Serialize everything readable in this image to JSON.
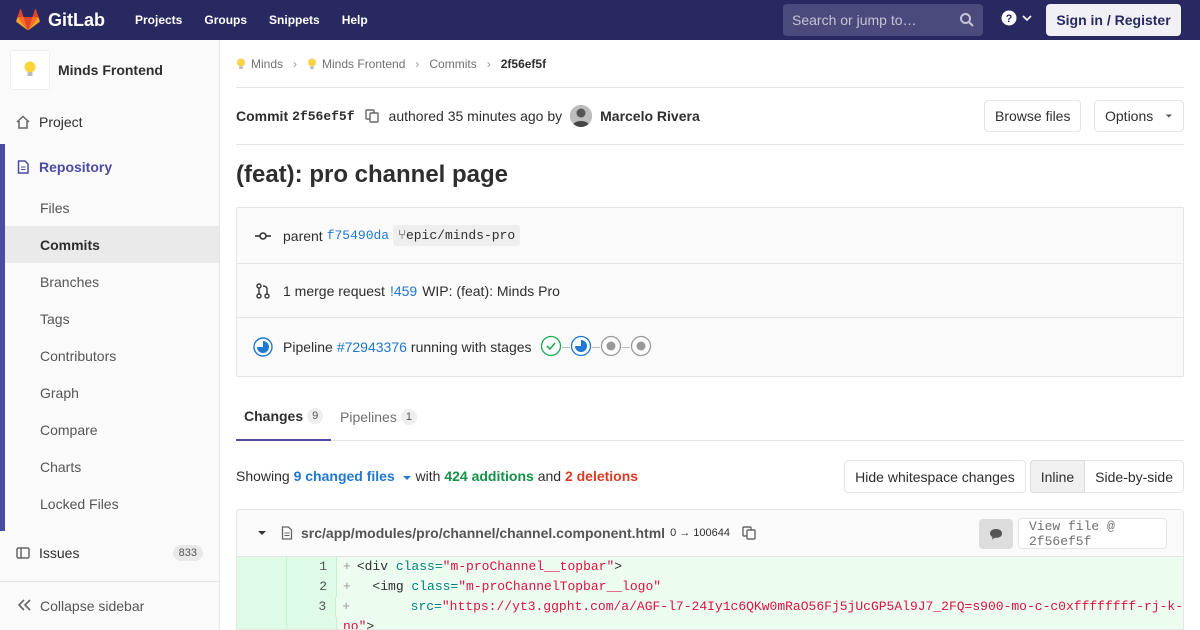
{
  "navbar": {
    "brand": "GitLab",
    "links": [
      "Projects",
      "Groups",
      "Snippets",
      "Help"
    ],
    "search_placeholder": "Search or jump to…",
    "signin": "Sign in / Register"
  },
  "sidebar": {
    "project_name": "Minds Frontend",
    "project": "Project",
    "repository": "Repository",
    "repo_items": [
      "Files",
      "Commits",
      "Branches",
      "Tags",
      "Contributors",
      "Graph",
      "Compare",
      "Charts",
      "Locked Files"
    ],
    "active_item": "Commits",
    "issues": "Issues",
    "issues_count": "833",
    "collapse": "Collapse sidebar"
  },
  "breadcrumbs": [
    "Minds",
    "Minds Frontend",
    "Commits",
    "2f56ef5f"
  ],
  "commit": {
    "label": "Commit",
    "sha": "2f56ef5f",
    "authored": "authored 35 minutes ago by",
    "author": "Marcelo Rivera",
    "browse_files": "Browse files",
    "options": "Options",
    "title": "(feat): pro channel page"
  },
  "info": {
    "parent_label": "parent",
    "parent_sha": "f75490da",
    "branch": "epic/minds-pro",
    "mr_text": "1 merge request",
    "mr_id": "!459",
    "mr_title": "WIP: (feat): Minds Pro",
    "pipeline_label": "Pipeline",
    "pipeline_id": "#72943376",
    "pipeline_status": "running with stages",
    "stages": [
      "success",
      "running",
      "pending",
      "pending"
    ]
  },
  "tabs": {
    "changes": "Changes",
    "changes_count": "9",
    "pipelines": "Pipelines",
    "pipelines_count": "1"
  },
  "summary": {
    "showing": "Showing",
    "changed_files": "9 changed files",
    "with": "with",
    "additions": "424 additions",
    "and": "and",
    "deletions": "2 deletions",
    "hide_ws": "Hide whitespace changes",
    "inline": "Inline",
    "side_by_side": "Side-by-side"
  },
  "file": {
    "path": "src/app/modules/pro/channel/channel.component.html",
    "mode": "0 → 100644",
    "view_file": "View file @ 2f56ef5f",
    "lines": [
      {
        "num": "1",
        "tag": "<div ",
        "attr": "class=",
        "str": "\"m-proChannel__topbar\"",
        "end": ">"
      },
      {
        "num": "2",
        "tag": "  <img ",
        "attr": "class=",
        "str": "\"m-proChannelTopbar__logo\"",
        "end": ""
      },
      {
        "num": "3",
        "tag": "       ",
        "attr": "src=",
        "str": "\"https://yt3.ggpht.com/a/AGF-l7-24Iy1c6QKw0mRaO56Fj5jUcGP5Al9J7_2FQ=s900-mo-c-c0xffffffff-rj-k-",
        "end": ""
      },
      {
        "num": "",
        "tag": "",
        "attr": "",
        "str": "no\"",
        "end": ">"
      }
    ]
  },
  "colors": {
    "navbar": "#292961",
    "accent": "#4b4ba3",
    "link": "#1f78d1",
    "additions": "#168f48",
    "deletions": "#db3b21"
  }
}
